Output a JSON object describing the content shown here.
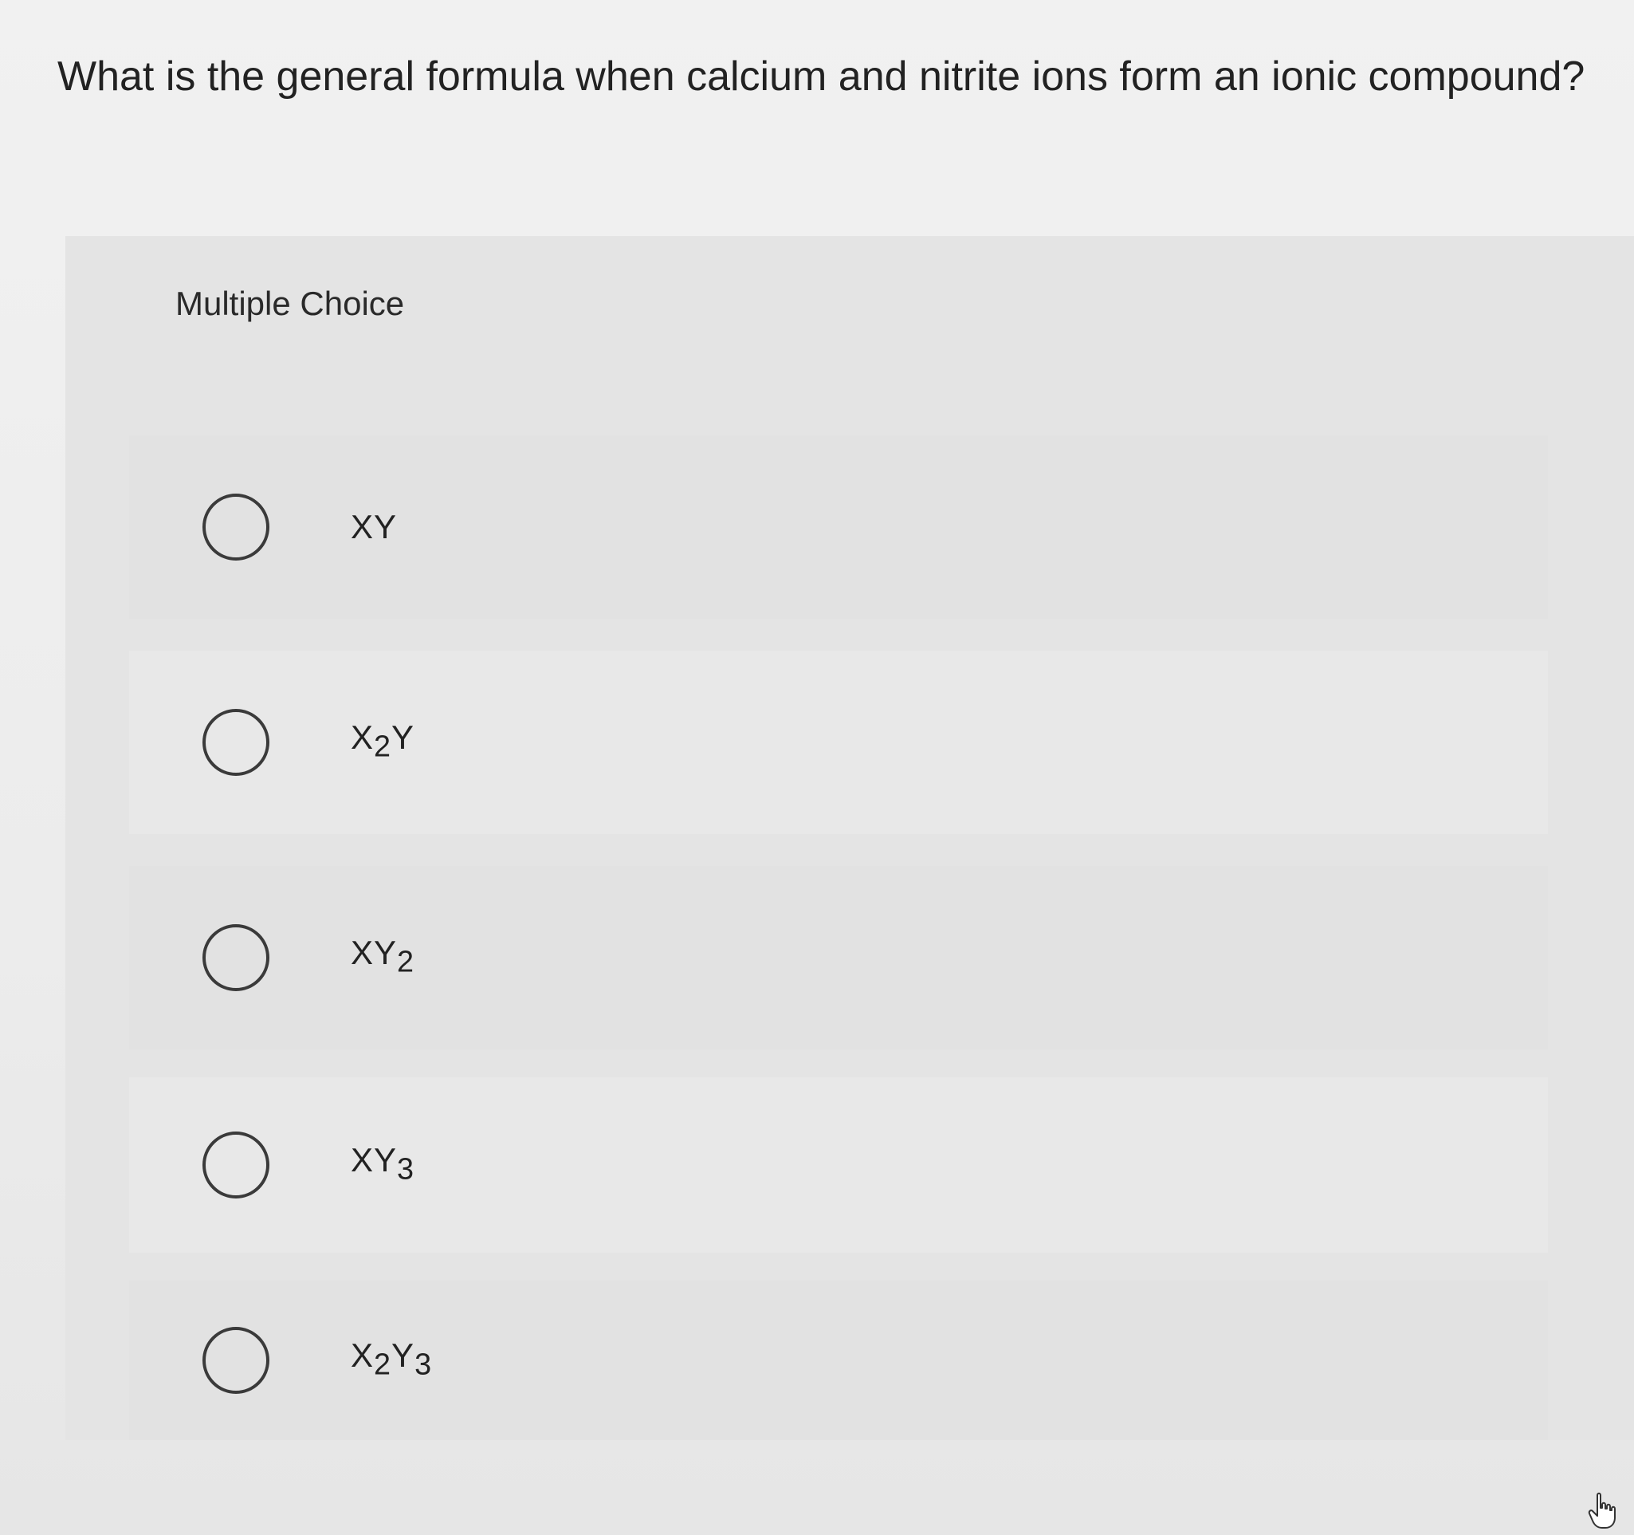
{
  "question": {
    "text": "What is the general formula when calcium and nitrite ions form an ionic compound?"
  },
  "multiple_choice": {
    "label": "Multiple Choice",
    "options": [
      {
        "text": "XY",
        "selected": false
      },
      {
        "text": "X2Y",
        "selected": false
      },
      {
        "text": "XY2",
        "selected": false
      },
      {
        "text": "XY3",
        "selected": false
      },
      {
        "text": "X2Y3",
        "selected": false
      }
    ]
  },
  "icons": {
    "cursor": "hand-pointer-icon"
  }
}
